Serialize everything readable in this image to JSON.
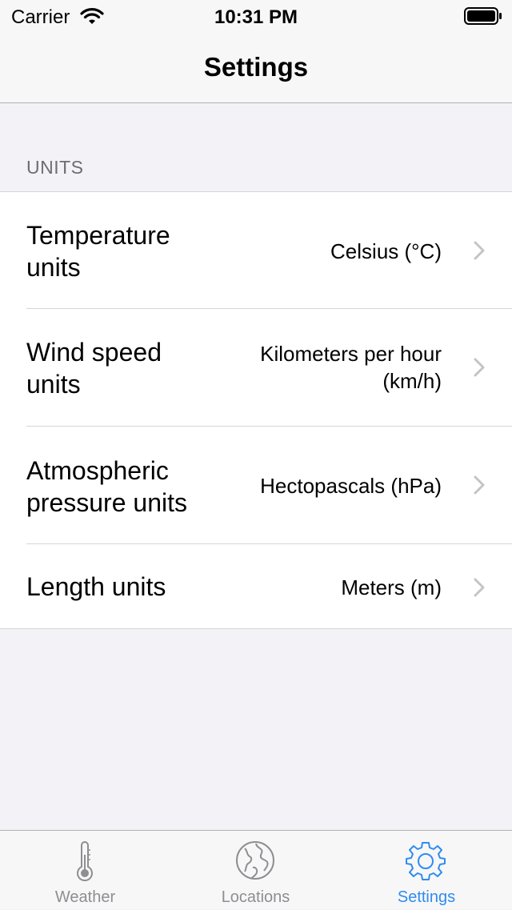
{
  "status_bar": {
    "carrier": "Carrier",
    "time": "10:31 PM"
  },
  "nav": {
    "title": "Settings"
  },
  "section": {
    "header": "UNITS"
  },
  "rows": [
    {
      "label": "Temperature units",
      "value": "Celsius (°C)"
    },
    {
      "label": "Wind speed units",
      "value": "Kilometers per hour (km/h)"
    },
    {
      "label": "Atmospheric pressure units",
      "value": "Hectopascals (hPa)"
    },
    {
      "label": "Length units",
      "value": "Meters (m)"
    }
  ],
  "tabs": [
    {
      "label": "Weather",
      "icon": "thermometer-icon",
      "active": false
    },
    {
      "label": "Locations",
      "icon": "globe-icon",
      "active": false
    },
    {
      "label": "Settings",
      "icon": "gear-icon",
      "active": true
    }
  ],
  "colors": {
    "accent": "#2f8cf0",
    "inactive": "#8e8e93",
    "background": "#f2f2f7",
    "bar": "#f7f7f7"
  }
}
